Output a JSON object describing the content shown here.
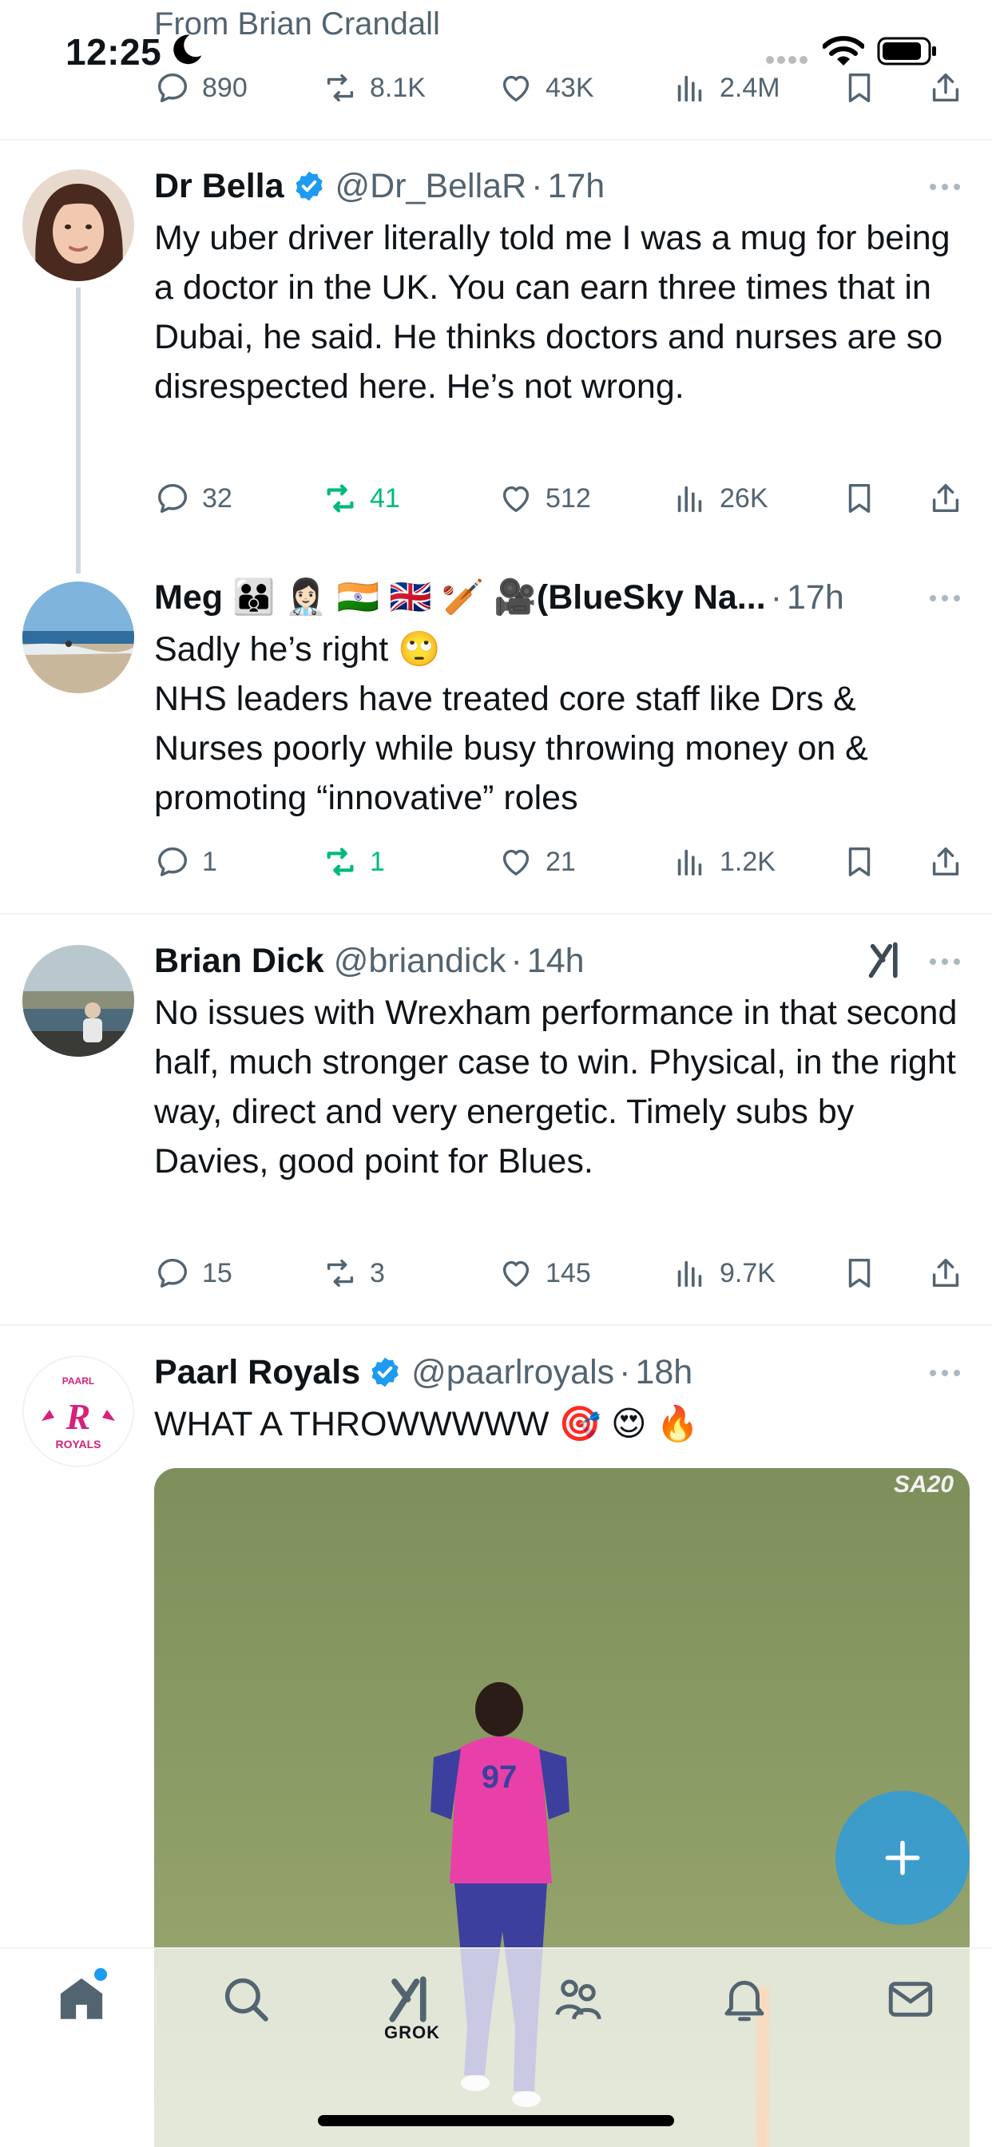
{
  "status_bar": {
    "time": "12:25",
    "context_line": "From Brian Crandall"
  },
  "top_actions": {
    "replies": "890",
    "reposts": "8.1K",
    "likes": "43K",
    "views": "2.4M"
  },
  "tweets": [
    {
      "name": "Dr Bella",
      "verified": true,
      "handle": "@Dr_BellaR",
      "time": "17h",
      "text": "My uber driver literally told me I was a mug for being a doctor in the UK. You can earn three times that in Dubai, he said. He thinks doctors and nurses are so disrespected here. He’s not wrong.",
      "replies": "32",
      "reposts": "41",
      "likes": "512",
      "views": "26K",
      "reposted_by_me": true
    },
    {
      "name": "Meg 🧑‍🧑‍🧒 👩🏻‍⚕️ 🇮🇳 🇬🇧 🏏 🎥(BlueSky Na...",
      "handle": "",
      "time": "17h",
      "text_line1": "Sadly he’s right 🙄",
      "text_rest": "NHS leaders have treated core staff like Drs & Nurses poorly while busy throwing money on & promoting “innovative” roles",
      "replies": "1",
      "reposts": "1",
      "likes": "21",
      "views": "1.2K",
      "reposted_by_me": true
    },
    {
      "name": "Brian Dick",
      "handle": "@briandick",
      "time": "14h",
      "text": "No issues with Wrexham performance in that second half, much stronger case to win. Physical, in the right way, direct and very energetic. Timely subs by Davies, good point for Blues.",
      "replies": "15",
      "reposts": "3",
      "likes": "145",
      "views": "9.7K",
      "grok_icon": "grok-logo-icon"
    },
    {
      "name": "Paarl Royals",
      "verified": true,
      "handle": "@paarlroyals",
      "time": "18h",
      "text": "WHAT A THROWWWWW 🎯 😍 🔥",
      "media_badge": "SA20",
      "avatar_text_top": "PAARL",
      "avatar_text_bottom": "ROYALS"
    }
  ],
  "tab_bar": {
    "items": [
      {
        "name": "home",
        "icon": "home-icon",
        "label": ""
      },
      {
        "name": "search",
        "icon": "search-icon",
        "label": ""
      },
      {
        "name": "grok",
        "icon": "grok-icon",
        "label": "GROK"
      },
      {
        "name": "communities",
        "icon": "people-icon",
        "label": ""
      },
      {
        "name": "notifications",
        "icon": "bell-icon",
        "label": ""
      },
      {
        "name": "messages",
        "icon": "mail-icon",
        "label": ""
      }
    ]
  },
  "fab": {
    "icon": "plus-icon"
  },
  "colors": {
    "accent": "#1d9bf0",
    "repost_active": "#00ba7c",
    "secondary_text": "#536471",
    "primary_text": "#0f1419"
  }
}
